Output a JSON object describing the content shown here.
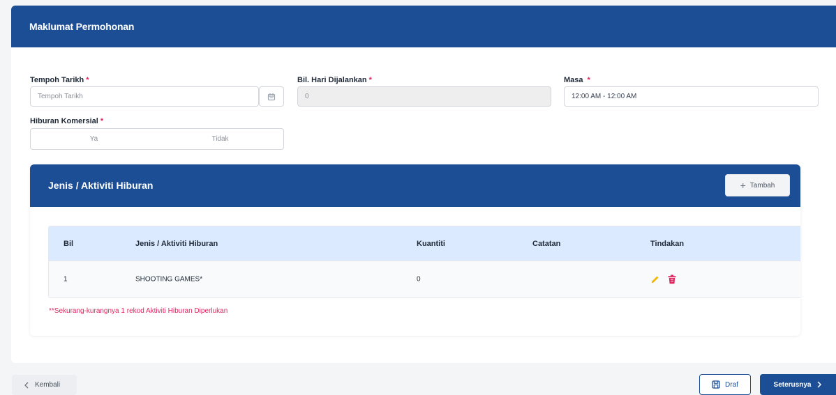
{
  "section": {
    "title": "Maklumat Permohonan"
  },
  "form": {
    "tempoh_tarikh": {
      "label": "Tempoh Tarikh",
      "required_mark": "*",
      "placeholder": "Tempoh Tarikh",
      "icon": "calendar-icon"
    },
    "bil_hari": {
      "label": "Bil. Hari Dijalankan",
      "required_mark": "*",
      "value": "0"
    },
    "masa": {
      "label": "Masa",
      "required_mark": "*",
      "value": "12:00 AM - 12:00 AM"
    },
    "hiburan_komersial": {
      "label": "Hiburan Komersial",
      "required_mark": "*",
      "options": [
        "Ya",
        "Tidak"
      ]
    }
  },
  "activities": {
    "title": "Jenis / Aktiviti Hiburan",
    "add_button": {
      "icon": "plus-icon",
      "label": "Tambah"
    },
    "columns": [
      "Bil",
      "Jenis / Aktiviti Hiburan",
      "Kuantiti",
      "Catatan",
      "Tindakan"
    ],
    "rows": [
      {
        "bil": "1",
        "jenis": "SHOOTING GAMES*",
        "kuantiti": "0",
        "catatan": "",
        "actions": [
          "edit-pencil-icon",
          "delete-trash-icon"
        ]
      }
    ],
    "note": "**Sekurang-kurangnya 1 rekod Aktiviti Hiburan Diperlukan"
  },
  "footer": {
    "back": {
      "icon": "chevron-left-icon",
      "label": "Kembali"
    },
    "draft": {
      "icon": "save-icon",
      "label": "Draf"
    },
    "next": {
      "label": "Seterusnya",
      "icon": "chevron-right-icon"
    }
  },
  "colors": {
    "primary": "#1c4e96",
    "required": "#e0245e",
    "table_header": "#dbeafe",
    "edit_icon": "#f5b800",
    "delete_icon": "#e0245e"
  }
}
